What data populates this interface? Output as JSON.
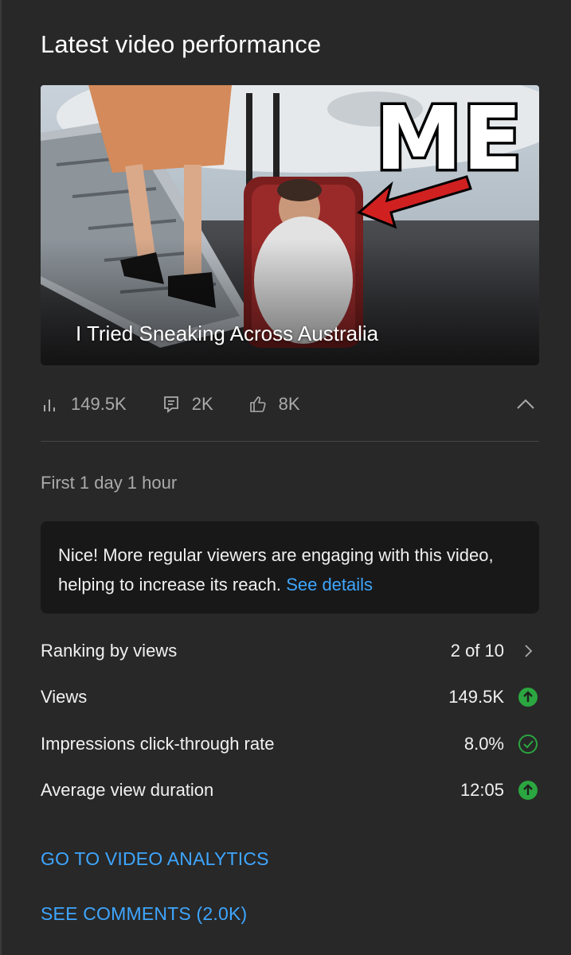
{
  "section_title": "Latest video performance",
  "video": {
    "title": "I Tried Sneaking Across Australia",
    "thumbnail_text": "ME"
  },
  "stats": {
    "views": "149.5K",
    "comments": "2K",
    "likes": "8K"
  },
  "period": "First 1 day 1 hour",
  "insight": {
    "text": "Nice! More regular viewers are engaging with this video, helping to increase its reach.",
    "link": "See details"
  },
  "metrics": [
    {
      "label": "Ranking by views",
      "value": "2 of 10",
      "indicator": "chevron-right-icon"
    },
    {
      "label": "Views",
      "value": "149.5K",
      "indicator": "arrow-up-circle-icon"
    },
    {
      "label": "Impressions click-through rate",
      "value": "8.0%",
      "indicator": "check-circle-icon"
    },
    {
      "label": "Average view duration",
      "value": "12:05",
      "indicator": "arrow-up-circle-icon"
    }
  ],
  "actions": {
    "analytics": "GO TO VIDEO ANALYTICS",
    "comments": "SEE COMMENTS (2.0K)"
  },
  "colors": {
    "background": "#282828",
    "link": "#3ea6ff",
    "positive": "#2ba640"
  }
}
